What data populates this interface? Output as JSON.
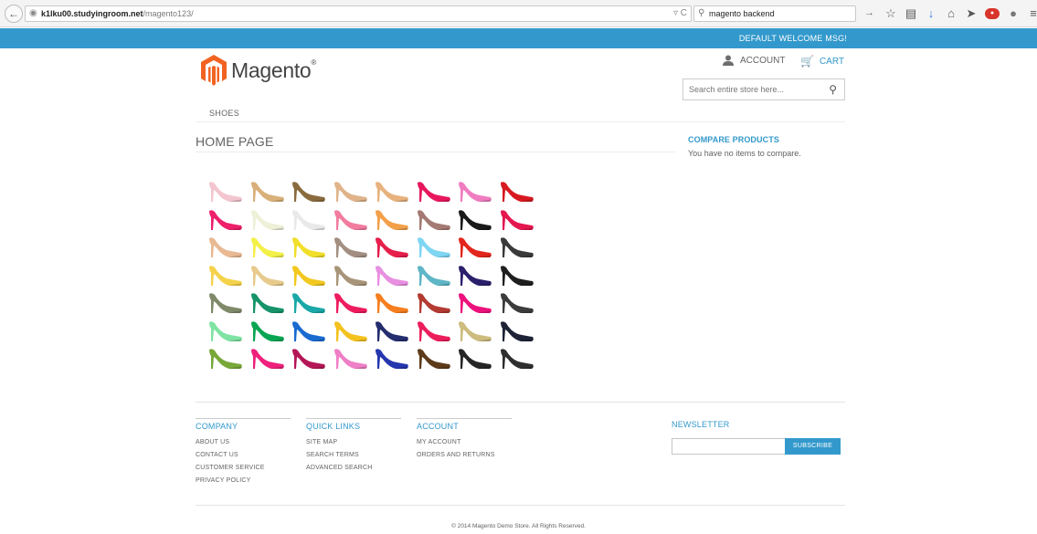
{
  "browser": {
    "url_host": "k1lku00.studyingroom.net",
    "url_path": "/magento123/",
    "search_query": "magento backend"
  },
  "welcome": {
    "text": "DEFAULT WELCOME MSG!"
  },
  "header": {
    "logo_text": "Magento",
    "account_label": "ACCOUNT",
    "cart_label": "CART",
    "search_placeholder": "Search entire store here..."
  },
  "nav": {
    "items": [
      {
        "label": "SHOES"
      }
    ]
  },
  "main": {
    "page_title": "HOME PAGE"
  },
  "sidebar": {
    "compare_title": "COMPARE PRODUCTS",
    "compare_empty": "You have no items to compare."
  },
  "shoe_colors": [
    [
      "#f3c6cf",
      "#d9b07a",
      "#8a6b3e",
      "#e0b48a",
      "#e8b27e",
      "#e8175d",
      "#f07cc0",
      "#d71920"
    ],
    [
      "#ee1f6b",
      "#eef0d8",
      "#e9e9e9",
      "#f27ca0",
      "#f3a04a",
      "#a47b74",
      "#1a1a1a",
      "#e4174f"
    ],
    [
      "#e8b993",
      "#f3f04a",
      "#f1df2a",
      "#a38f82",
      "#e61f4b",
      "#7ed6f2",
      "#e3261d",
      "#3a3a3a"
    ],
    [
      "#f4d24a",
      "#e7cb8d",
      "#f2c81f",
      "#a89479",
      "#e88fe0",
      "#5fb6c6",
      "#2a1f6b",
      "#1f1f1f"
    ],
    [
      "#7f8a6a",
      "#16936a",
      "#1aa7a7",
      "#ee1c5f",
      "#f77e1e",
      "#b33b32",
      "#ec127c",
      "#3c3c3c"
    ],
    [
      "#7fe3a3",
      "#0aa553",
      "#1a6bd0",
      "#f4c21f",
      "#242d6e",
      "#ec1d5b",
      "#cdbc7e",
      "#1e2336"
    ],
    [
      "#78a83a",
      "#ef1f7c",
      "#b41657",
      "#ef7fc7",
      "#2536ae",
      "#5d3b1a",
      "#262626",
      "#2f2f2f"
    ]
  ],
  "footer": {
    "columns": [
      {
        "title": "COMPANY",
        "links": [
          "ABOUT US",
          "CONTACT US",
          "CUSTOMER SERVICE",
          "PRIVACY POLICY"
        ]
      },
      {
        "title": "QUICK LINKS",
        "links": [
          "SITE MAP",
          "SEARCH TERMS",
          "ADVANCED SEARCH"
        ]
      },
      {
        "title": "ACCOUNT",
        "links": [
          "MY ACCOUNT",
          "ORDERS AND RETURNS"
        ]
      }
    ],
    "newsletter_title": "NEWSLETTER",
    "subscribe_label": "SUBSCRIBE",
    "copyright": "© 2014 Magento Demo Store. All Rights Reserved."
  },
  "colors": {
    "accent": "#3399cc",
    "text": "#636363",
    "logo_orange": "#f26322"
  }
}
